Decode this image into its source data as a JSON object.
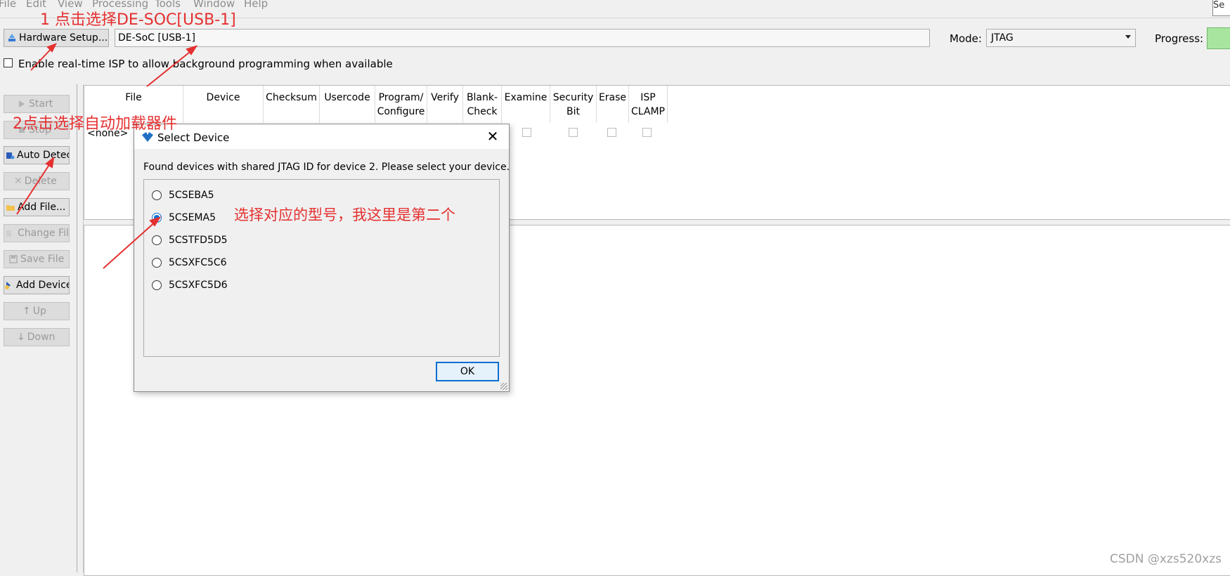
{
  "menu": [
    "File",
    "Edit",
    "View",
    "Processing",
    "Tools",
    "Window",
    "Help"
  ],
  "menu_edge_text": "Se",
  "toolbar": {
    "hardware_setup_label": "Hardware Setup...",
    "hardware_value": "DE-SoC [USB-1]",
    "mode_label": "Mode:",
    "mode_value": "JTAG",
    "progress_label": "Progress:",
    "isp_label": "Enable real-time ISP to allow background programming when available"
  },
  "sidebar": {
    "start": "Start",
    "stop": "Stop",
    "auto_detect": "Auto Detec",
    "delete": "Delete",
    "add_file": "Add File...",
    "change_file": "Change File",
    "save_file": "Save File",
    "add_device": "Add Device",
    "up": "Up",
    "down": "Down"
  },
  "table": {
    "headers": [
      "File",
      "Device",
      "Checksum",
      "Usercode",
      "Program/\nConfigure",
      "Verify",
      "Blank-\nCheck",
      "Examine",
      "Security\nBit",
      "Erase",
      "ISP\nCLAMP"
    ],
    "row_file": "<none>"
  },
  "dialog": {
    "title": "Select Device",
    "message": "Found devices with shared JTAG ID for device 2. Please select your device.",
    "options": [
      "5CSEBA5",
      "5CSEMA5",
      "5CSTFD5D5",
      "5CSXFC5C6",
      "5CSXFC5D6"
    ],
    "selected": "5CSEMA5",
    "ok_label": "OK"
  },
  "annotations": {
    "step1": "1 点击选择DE-SOC[USB-1]",
    "step2": "2点击选择自动加载器件",
    "step3": "选择对应的型号，我这里是第二个"
  },
  "watermark": "CSDN @xzs520xzs",
  "colors": {
    "annotation": "#e53030",
    "accent": "#0a6ed1",
    "progress": "#a8e6a0"
  }
}
